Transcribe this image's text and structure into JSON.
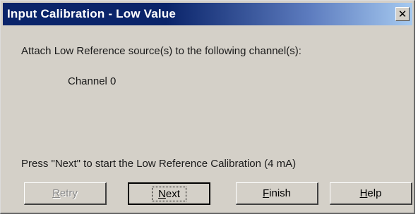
{
  "window": {
    "title": "Input Calibration - Low Value",
    "close_label": "✕"
  },
  "content": {
    "instruction": "Attach Low Reference source(s) to the following channel(s):",
    "channel": "Channel 0",
    "press_next": "Press \"Next\" to start the Low Reference Calibration (4 mA)"
  },
  "buttons": {
    "retry": {
      "prefix": "",
      "mnemonic": "R",
      "rest": "etry",
      "enabled": false
    },
    "next": {
      "prefix": "",
      "mnemonic": "N",
      "rest": "ext",
      "enabled": true,
      "focused": true
    },
    "finish": {
      "prefix": "",
      "mnemonic": "F",
      "rest": "inish",
      "enabled": true
    },
    "help": {
      "prefix": "",
      "mnemonic": "H",
      "rest": "elp",
      "enabled": true
    }
  },
  "colors": {
    "titlebar_start": "#0a246a",
    "titlebar_end": "#a6caf0",
    "dialog_face": "#d4d0c8",
    "disabled_text": "#8a8a8a"
  }
}
